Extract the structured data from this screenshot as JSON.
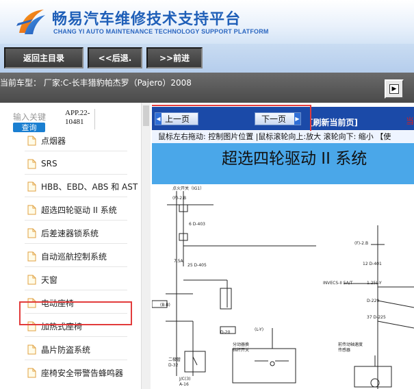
{
  "header": {
    "title": "畅易汽车维修技术支持平台",
    "subtitle": "CHANG YI AUTO MAINTENANCE TECHNOLOGY SUPPORT PLATFORM"
  },
  "nav": {
    "home": "返回主目录",
    "back": "<<后退.",
    "forward": ">>前进"
  },
  "car": {
    "label": "当前车型： 厂家:C-长丰猎豹帕杰罗（Pajero）2008"
  },
  "left": {
    "search_label": "输入关键",
    "search_button": "查询",
    "app_version": "APP.22-10481",
    "items": [
      "点烟器",
      "SRS",
      "HBB、EBD、ABS 和 AST",
      "超选四轮驱动 II 系统",
      "后差速器锁系统",
      "自动巡航控制系统",
      "天窗",
      "电动座椅",
      "加热式座椅",
      "晶片防盗系统",
      "座椅安全带警告蜂鸣器"
    ]
  },
  "right": {
    "prev": "上一页",
    "next": "下一页",
    "refresh": "[刷新当前页]",
    "cut_text": "当",
    "hint": "鼠标左右拖动: 控制图片位置 |鼠标滚轮向上:放大  滚轮向下: 缩小 【使",
    "diagram_title": "超选四轮驱动 II 系统"
  },
  "colors": {
    "brand_blue": "#1f5fb8",
    "pager_blue": "#1b4aa8",
    "diagram_header": "#4aa7e9",
    "highlight": "#e23b3b",
    "search_button": "#1a7fd1"
  },
  "icons": {
    "logo": "brand-logo-icon",
    "doc": "document-icon",
    "toggle": "panel-toggle-icon",
    "arrow_left": "arrow-left-icon",
    "arrow_right": "arrow-right-icon"
  }
}
